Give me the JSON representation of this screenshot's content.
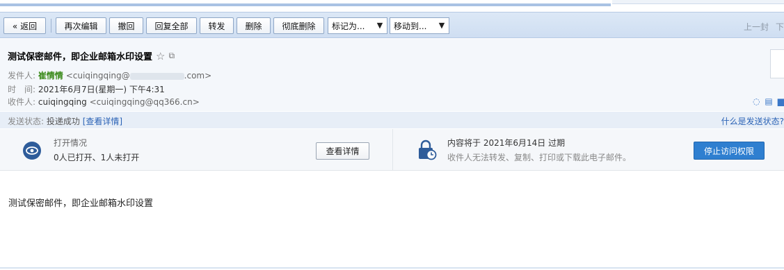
{
  "toolbar": {
    "back": "« 返回",
    "edit_again": "再次编辑",
    "recall": "撤回",
    "reply_all": "回复全部",
    "forward": "转发",
    "delete": "删除",
    "delete_permanently": "彻底删除",
    "mark_as": "标记为...",
    "move_to": "移动到...",
    "prev": "上一封",
    "next": "下"
  },
  "email": {
    "subject": "测试保密邮件，即企业邮箱水印设置",
    "from_label": "发件人:",
    "from_name": "崔情情",
    "from_addr_start": "<cuiqingqing@",
    "from_addr_end": ".com>",
    "time_label": "时　间:",
    "time_value": "2021年6月7日(星期一) 下午4:31",
    "to_label": "收件人:",
    "to_name": "cuiqingqing",
    "to_addr": "<cuiqingqing@qq366.cn>",
    "body": "测试保密邮件，即企业邮箱水印设置"
  },
  "status": {
    "label": "发送状态:",
    "value": "投递成功",
    "link": "[查看详情]",
    "help": "什么是发送状态?"
  },
  "open_card": {
    "title": "打开情况",
    "value": "0人已打开、1人未打开",
    "button": "查看详情"
  },
  "expire_card": {
    "title": "内容将于 2021年6月14日 过期",
    "desc": "收件人无法转发、复制、打印或下载此电子邮件。",
    "button": "停止访问权限"
  },
  "colors": {
    "toolbar_bg": "#cfdef2",
    "accent": "#2f7fd0",
    "sender": "#3a8a1a",
    "link": "#2b63b6"
  }
}
